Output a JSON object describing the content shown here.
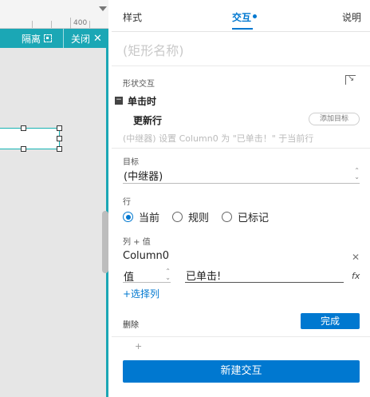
{
  "ruler": {
    "label": "400"
  },
  "canvas_toolbar": {
    "isolate_label": "隔离",
    "close_label": "关闭"
  },
  "tabs": {
    "styles": "样式",
    "interactions": "交互",
    "notes": "说明"
  },
  "shape_name_placeholder": "(矩形名称)",
  "interactions_section": {
    "title": "形状交互",
    "event": "单击时",
    "action": "更新行",
    "add_target": "添加目标",
    "summary": "(中继器) 设置 Column0 为 \"已单击！\" 于当前行"
  },
  "target": {
    "label": "目标",
    "value": "(中继器)"
  },
  "row": {
    "label": "行",
    "options": [
      {
        "label": "当前",
        "selected": true
      },
      {
        "label": "规则",
        "selected": false
      },
      {
        "label": "已标记",
        "selected": false
      }
    ]
  },
  "columns": {
    "label": "列 + 值",
    "column_name": "Column0",
    "value_type": "值",
    "value_text": "已单击!",
    "fx": "fx",
    "select_columns": "+选择列"
  },
  "footer": {
    "delete": "删除",
    "done": "完成",
    "add": "+",
    "new_interaction": "新建交互"
  },
  "colors": {
    "accent": "#0078d0",
    "teal": "#1ba7b5"
  }
}
